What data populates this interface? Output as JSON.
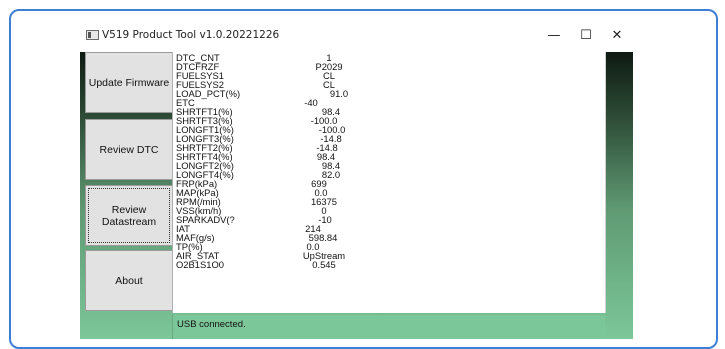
{
  "window": {
    "title": "V519 Product Tool v1.0.20221226",
    "minimize": "—",
    "maximize": "☐",
    "close": "✕"
  },
  "sidebar": {
    "buttons": [
      {
        "label": "Update Firmware"
      },
      {
        "label": "Review DTC"
      },
      {
        "label": "Review Datastream"
      },
      {
        "label": "About"
      }
    ]
  },
  "datastream": {
    "rows": [
      {
        "name": "DTC_CNT",
        "value": "1"
      },
      {
        "name": "DTCFRZF",
        "value": "P2029"
      },
      {
        "name": "FUELSYS1",
        "value": "CL"
      },
      {
        "name": "FUELSYS2",
        "value": "CL"
      },
      {
        "name": "LOAD_PCT(%)",
        "value": "91.0"
      },
      {
        "name": "ETC",
        "value": "-40"
      },
      {
        "name": "SHRTFT1(%)",
        "value": "98.4"
      },
      {
        "name": "SHRTFT3(%)",
        "value": "-100.0"
      },
      {
        "name": "LONGFT1(%)",
        "value": "-100.0"
      },
      {
        "name": "LONGFT3(%)",
        "value": "-14.8"
      },
      {
        "name": "SHRTFT2(%)",
        "value": "-14.8"
      },
      {
        "name": "SHRTFT4(%)",
        "value": "98.4"
      },
      {
        "name": "LONGFT2(%)",
        "value": "98.4"
      },
      {
        "name": "LONGFT4(%)",
        "value": "82.0"
      },
      {
        "name": "FRP(kPa)",
        "value": "699"
      },
      {
        "name": "MAP(kPa)",
        "value": "0.0"
      },
      {
        "name": "RPM(/min)",
        "value": "16375"
      },
      {
        "name": "VSS(km/h)",
        "value": "0"
      },
      {
        "name": "SPARKADV(?",
        "value": "-10"
      },
      {
        "name": "IAT",
        "value": "214"
      },
      {
        "name": "MAF(g/s)",
        "value": "598.84"
      },
      {
        "name": "TP(%)",
        "value": "0.0"
      },
      {
        "name": "AIR_STAT",
        "value": "UpStream"
      },
      {
        "name": "O2B1S1O0",
        "value": "0.545"
      }
    ]
  },
  "status": {
    "text": "USB connected."
  },
  "colors": {
    "frame_border": "#3d7fd6",
    "status_green": "#7cc79a"
  }
}
